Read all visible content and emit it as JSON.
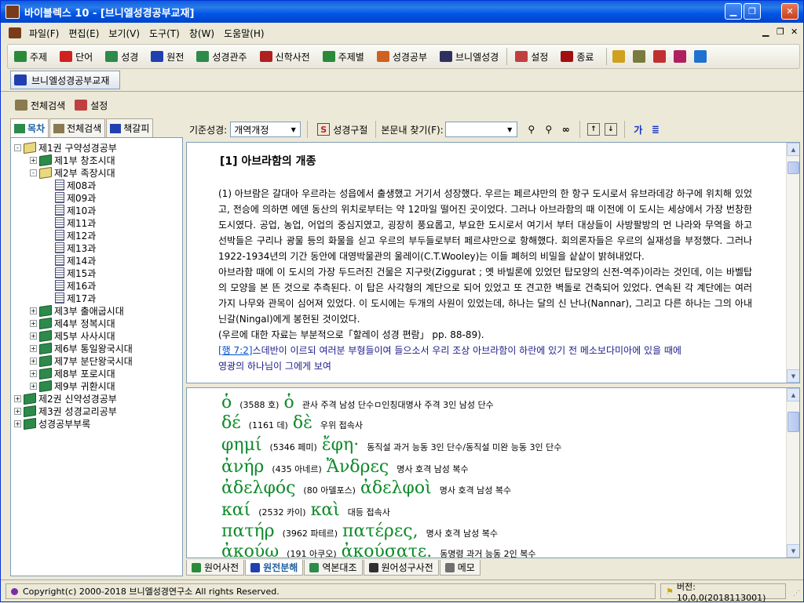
{
  "window": {
    "title": "바이블렉스 10 - [브니엘성경공부교재]"
  },
  "menu": [
    "파일(F)",
    "편집(E)",
    "보기(V)",
    "도구(T)",
    "창(W)",
    "도움말(H)"
  ],
  "toolbar": [
    {
      "label": "주제",
      "icon": "green-bracket-icon",
      "color": "#2a8a3a"
    },
    {
      "label": "단어",
      "icon": "red-bracket-icon",
      "color": "#d02020"
    },
    {
      "label": "성경",
      "icon": "green-book-icon",
      "color": "#2d8a4b"
    },
    {
      "label": "원전",
      "icon": "blue-book-icon",
      "color": "#2040b0"
    },
    {
      "label": "성경관주",
      "icon": "green-book-icon",
      "color": "#2d8a4b"
    },
    {
      "label": "신학사전",
      "icon": "red-book-icon",
      "color": "#b02020"
    },
    {
      "label": "주제별",
      "icon": "tree-icon",
      "color": "#2a8a3a"
    },
    {
      "label": "성경공부",
      "icon": "study-book-icon",
      "color": "#d06020"
    },
    {
      "label": "브니엘성경",
      "icon": "dark-book-icon",
      "color": "#303060"
    },
    {
      "label": "설정",
      "icon": "settings-icon",
      "color": "#c04040"
    },
    {
      "label": "종료",
      "icon": "exit-icon",
      "color": "#a01010"
    }
  ],
  "doc_tab": {
    "label": "브니엘성경공부교재"
  },
  "sub_toolbar": {
    "search_all": "전체검색",
    "settings": "설정"
  },
  "left_tabs": [
    "목차",
    "전체검색",
    "책갈피"
  ],
  "tree": [
    {
      "label": "제1권 구약성경공부",
      "level": 0,
      "expander": "-",
      "icon": "book-open"
    },
    {
      "label": "제1부 창조시대",
      "level": 1,
      "expander": "+",
      "icon": "book"
    },
    {
      "label": "제2부 족장시대",
      "level": 1,
      "expander": "-",
      "icon": "book-open"
    },
    {
      "label": "제08과",
      "level": 2,
      "expander": "",
      "icon": "page"
    },
    {
      "label": "제09과",
      "level": 2,
      "expander": "",
      "icon": "page"
    },
    {
      "label": "제10과",
      "level": 2,
      "expander": "",
      "icon": "page"
    },
    {
      "label": "제11과",
      "level": 2,
      "expander": "",
      "icon": "page"
    },
    {
      "label": "제12과",
      "level": 2,
      "expander": "",
      "icon": "page"
    },
    {
      "label": "제13과",
      "level": 2,
      "expander": "",
      "icon": "page"
    },
    {
      "label": "제14과",
      "level": 2,
      "expander": "",
      "icon": "page"
    },
    {
      "label": "제15과",
      "level": 2,
      "expander": "",
      "icon": "page"
    },
    {
      "label": "제16과",
      "level": 2,
      "expander": "",
      "icon": "page"
    },
    {
      "label": "제17과",
      "level": 2,
      "expander": "",
      "icon": "page"
    },
    {
      "label": "제3부 출애굽시대",
      "level": 1,
      "expander": "+",
      "icon": "book"
    },
    {
      "label": "제4부 정복시대",
      "level": 1,
      "expander": "+",
      "icon": "book"
    },
    {
      "label": "제5부 사사시대",
      "level": 1,
      "expander": "+",
      "icon": "book"
    },
    {
      "label": "제6부 통일왕국시대",
      "level": 1,
      "expander": "+",
      "icon": "book"
    },
    {
      "label": "제7부 분단왕국시대",
      "level": 1,
      "expander": "+",
      "icon": "book"
    },
    {
      "label": "제8부 포로시대",
      "level": 1,
      "expander": "+",
      "icon": "book"
    },
    {
      "label": "제9부 귀환시대",
      "level": 1,
      "expander": "+",
      "icon": "book"
    },
    {
      "label": "제2권 신약성경공부",
      "level": 0,
      "expander": "+",
      "icon": "book"
    },
    {
      "label": "제3권 성경교리공부",
      "level": 0,
      "expander": "+",
      "icon": "book"
    },
    {
      "label": "성경공부부록",
      "level": 0,
      "expander": "+",
      "icon": "book"
    }
  ],
  "right_toolbar": {
    "base_label": "기준성경:",
    "base_value": "개역개정",
    "verse_button": "성경구절",
    "find_label": "본문내 찾기(F):",
    "find_value": ""
  },
  "article": {
    "heading": "[1] 아브라함의 개종",
    "paragraphs": [
      "(1) 아브람은 갈대아 우르라는 성읍에서 출생했고 거기서 성장했다. 우르는 페르샤만의 한 항구 도시로서 유브라데강 하구에 위치해 있었고, 전승에 의하면 에덴 동산의 위치로부터는 약 12마일 떨어진 곳이었다. 그러나 아브라함의 때 이전에 이 도시는 세상에서 가장 번창한 도시였다. 공업, 농업, 어업의 중심지였고, 굉장히 풍요롭고, 부요한 도시로서 여기서 부터 대상들이 사방팔방의 먼 나라와 무역을 하고 선박들은 구리나 광물 등의 화물을 싣고 우르의 부두들로부터 페르샤만으로 항해했다. 회의론자들은 우르의 실재성을 부정했다. 그러나 1922-1934년의 기간 동안에 대영박물관의 울레이(C.T.Wooley)는 이들 폐허의 비밀을 샅샅이 밝혀내었다.",
      "아브라함 때에 이 도시의 가장 두드러진 건물은 지구랏(Ziggurat ; 옛 바빌론에 있었던 탑모양의 신전-역주)이라는 것인데, 이는 바벨탑의 모양을 본 뜬 것으로 추측된다. 이 탑은 사각형의 계단으로 되어 있었고 또 견고한 벽돌로 건축되어 있었다. 연속된 각 계단에는 여러가지 나무와 관목이 심어져 있었다. 이 도시에는 두개의 사원이 있었는데, 하나는 달의 신 난나(Nannar), 그리고 다른 하나는 그의 아내 닌갈(Ningal)에게 봉헌된 것이었다.",
      "(우르에 대한 자료는 부분적으로「할레이 성경 편람」 pp. 88-89)."
    ],
    "verse_ref": "[행 7:2]",
    "verse_text": "스데반이 이르되 여러분 부형들이여 들으소서 우리 조상 아브라함이 하란에 있기 전 메소보다미아에 있을 때에",
    "cut_line": "영광의 하나님이 그에게 보여"
  },
  "greek": [
    {
      "word": "ὁ",
      "num": "(3588 호)",
      "form": "ὁ",
      "info": "관사 주격 남성 단수ㅁ인칭대명사 주격 3인 남성 단수"
    },
    {
      "word": "δέ",
      "num": "(1161 데)",
      "form": "δὲ",
      "info": "우위 접속사"
    },
    {
      "word": "φημί",
      "num": "(5346 페미)",
      "form": "ἔφη·",
      "info": "동직설 과거 능동 3인 단수/동직설 미완 능동 3인 단수"
    },
    {
      "word": "ἀνήρ",
      "num": "(435 아네르)",
      "form": "Ἄνδρες",
      "info": "명사 호격 남성 복수"
    },
    {
      "word": "ἀδελφός",
      "num": "(80 아델포스)",
      "form": "ἀδελφοὶ",
      "info": "명사 호격 남성 복수"
    },
    {
      "word": "καί",
      "num": "(2532 카이)",
      "form": "καὶ",
      "info": "대등 접속사"
    },
    {
      "word": "πατήρ",
      "num": "(3962 파테르)",
      "form": "πατέρες,",
      "info": "명사 호격 남성 복수"
    },
    {
      "word": "ἀκούω",
      "num": "(191 아쿠오)",
      "form": "ἀκούσατε.",
      "info": "동명령 과거 능동 2인 복수"
    }
  ],
  "bottom_tabs": [
    {
      "label": "원어사전",
      "icon": "green-bracket-icon",
      "color": "#2a8a3a"
    },
    {
      "label": "원전분해",
      "icon": "blue-book-icon",
      "color": "#2040b0"
    },
    {
      "label": "역본대조",
      "icon": "green-book-icon",
      "color": "#2d8a4b"
    },
    {
      "label": "원어성구사전",
      "icon": "dark-book-icon",
      "color": "#303030"
    },
    {
      "label": "메모",
      "icon": "memo-icon",
      "color": "#707070"
    }
  ],
  "status": {
    "copyright": "Copyright(c) 2000-2018 브니엘성경연구소 All rights Reserved.",
    "version": "버전: 10,0,0(2018113001)"
  }
}
